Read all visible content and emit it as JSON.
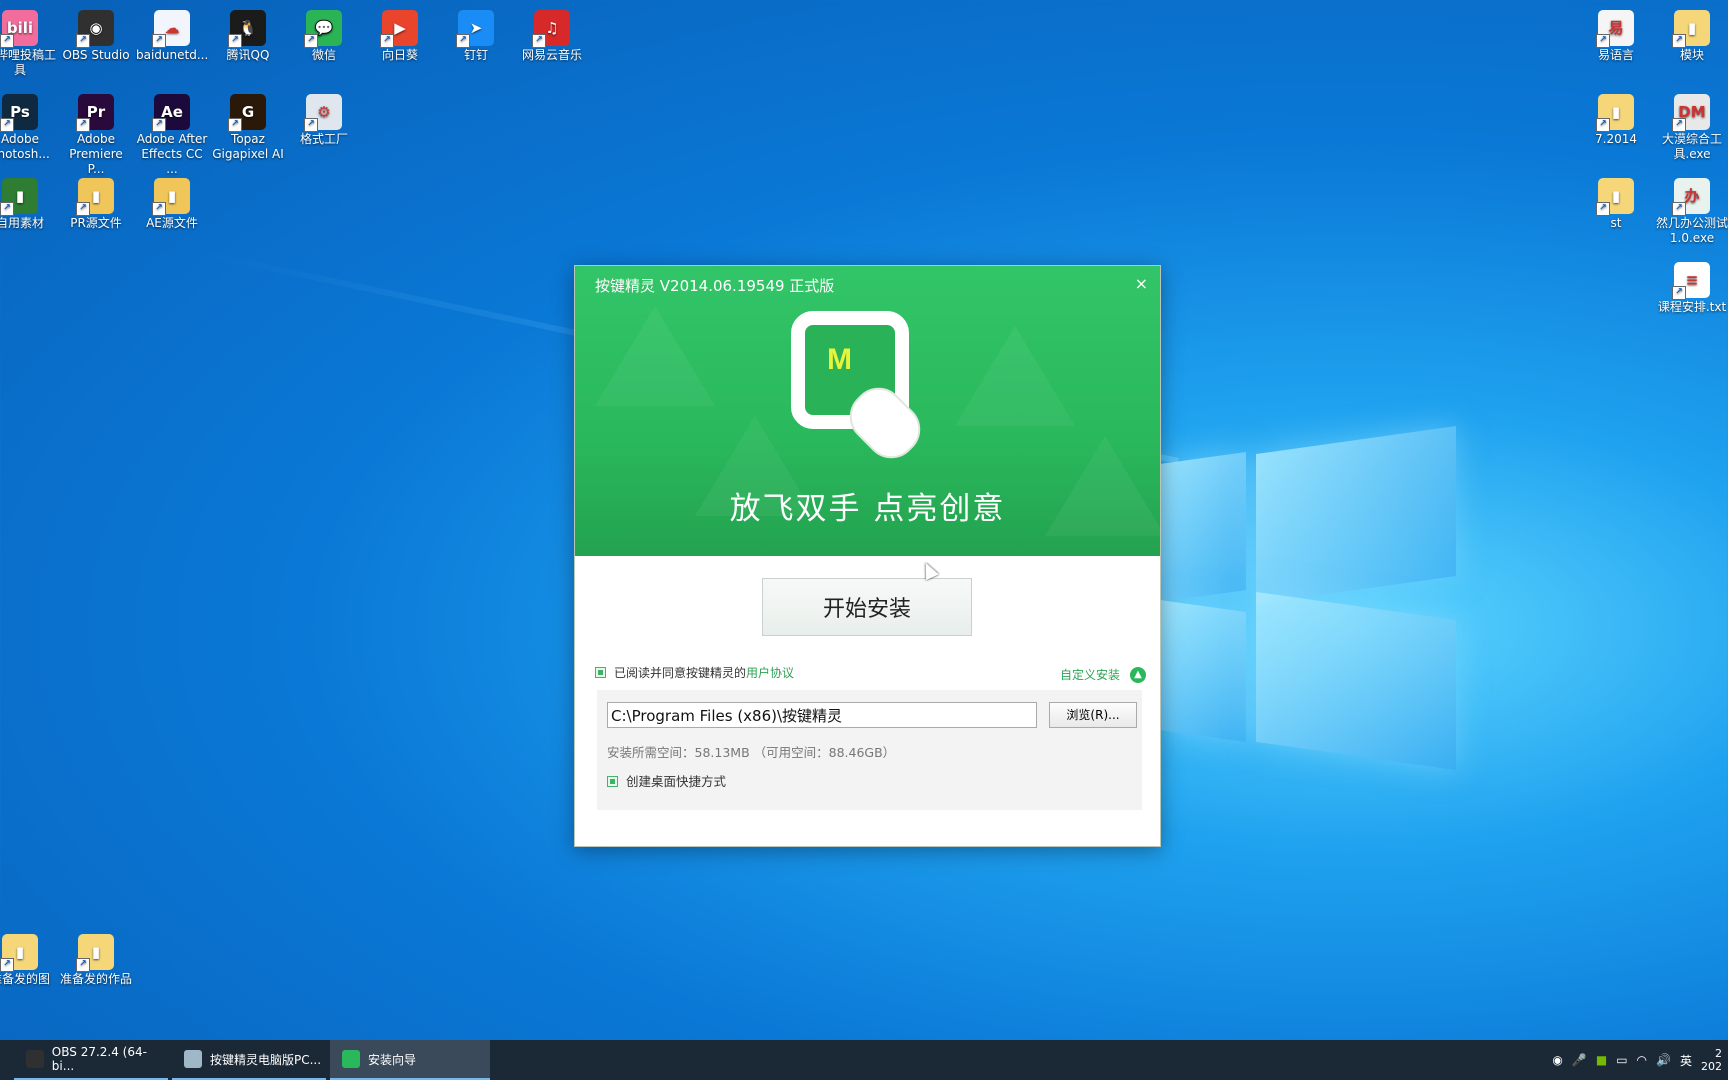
{
  "desktop": {
    "left_icons": [
      {
        "name": "bilibili-upload-tool-shortcut",
        "label": "哩哔哩投稿工具",
        "color": "#f36d9c",
        "text": "bili"
      },
      {
        "name": "obs-studio-shortcut",
        "label": "OBS Studio",
        "color": "#303030",
        "text": "◉"
      },
      {
        "name": "baidunetdisk-shortcut",
        "label": "baidunetd...",
        "color": "#f2f6fc",
        "text": "☁"
      },
      {
        "name": "tencent-qq-shortcut",
        "label": "腾讯QQ",
        "color": "#1b1b1b",
        "text": "🐧"
      },
      {
        "name": "wechat-shortcut",
        "label": "微信",
        "color": "#2bb455",
        "text": "💬"
      },
      {
        "name": "sunlogin-shortcut",
        "label": "向日葵",
        "color": "#e9452d",
        "text": "▶"
      },
      {
        "name": "dingtalk-shortcut",
        "label": "钉钉",
        "color": "#1a8cf5",
        "text": "➤"
      },
      {
        "name": "netease-music-shortcut",
        "label": "网易云音乐",
        "color": "#d8292a",
        "text": "♫"
      },
      {
        "name": "photoshop-shortcut",
        "label": "Adobe Photosh...",
        "color": "#0f2a40",
        "text": "Ps"
      },
      {
        "name": "premiere-shortcut",
        "label": "Adobe Premiere P...",
        "color": "#2a0a3c",
        "text": "Pr"
      },
      {
        "name": "after-effects-shortcut",
        "label": "Adobe After Effects CC ...",
        "color": "#1c0a3d",
        "text": "Ae"
      },
      {
        "name": "topaz-gigapixel-shortcut",
        "label": "Topaz Gigapixel AI",
        "color": "#2a1808",
        "text": "G"
      },
      {
        "name": "format-factory-shortcut",
        "label": "格式工厂",
        "color": "#dfe6ee",
        "text": "⚙"
      },
      {
        "name": "materials-folder-shortcut",
        "label": "自用素材",
        "color": "#2e7d32",
        "text": "▮"
      },
      {
        "name": "pr-source-folder-shortcut",
        "label": "PR源文件",
        "color": "#f0c65a",
        "text": "▮"
      },
      {
        "name": "ae-source-folder-shortcut",
        "label": "AE源文件",
        "color": "#f0c65a",
        "text": "▮"
      }
    ],
    "right_icons": [
      {
        "name": "eyuyan-shortcut",
        "label": "易语言",
        "color": "#f5f5f5",
        "text": "易"
      },
      {
        "name": "module-folder",
        "label": "模块",
        "color": "#f5d77a",
        "text": "▮"
      },
      {
        "name": "folder-7-2014",
        "label": "7.2014",
        "color": "#f5d77a",
        "text": "▮"
      },
      {
        "name": "dm-tool-exe",
        "label": "大漠综合工具.exe",
        "color": "#e8e8e8",
        "text": "DM"
      },
      {
        "name": "st-shortcut",
        "label": "st",
        "color": "#f5d77a",
        "text": "▮"
      },
      {
        "name": "office-test-exe",
        "label": "然几办公测试1.0.exe",
        "color": "#e8f3ef",
        "text": "办"
      },
      {
        "name": "schedule-txt",
        "label": "课程安排.txt",
        "color": "#ffffff",
        "text": "≡"
      }
    ],
    "bottom_icons": [
      {
        "name": "prepared-images-folder",
        "label": "准备发的图",
        "color": "#f5d77a",
        "text": "▮"
      },
      {
        "name": "prepared-works-folder",
        "label": "准备发的作品",
        "color": "#f5d77a",
        "text": "▮"
      }
    ]
  },
  "installer": {
    "title": "按键精灵 V2014.06.19549 正式版",
    "close": "×",
    "logo_letter": "M",
    "slogan": "放飞双手  点亮创意",
    "start_button": "开始安装",
    "agree_text": "已阅读并同意按键精灵的",
    "agree_link": "用户协议",
    "custom_install": "自定义安装",
    "install_path": "C:\\Program Files (x86)\\按键精灵",
    "browse_button": "浏览(R)...",
    "space_info": "安装所需空间：58.13MB  （可用空间：88.46GB）",
    "create_shortcut": "创建桌面快捷方式"
  },
  "taskbar": {
    "items": [
      {
        "name": "taskbar-obs",
        "label": "OBS 27.2.4 (64-bi...",
        "color": "#303030"
      },
      {
        "name": "taskbar-ajjl-pc",
        "label": "按键精灵电脑版PC...",
        "color": "#9fb8c8"
      },
      {
        "name": "taskbar-install-wizard",
        "label": "安装向导",
        "color": "#2ab85c"
      }
    ],
    "tray_language": "英",
    "tray_clock_partial": "2",
    "tray_year_partial": "202"
  }
}
